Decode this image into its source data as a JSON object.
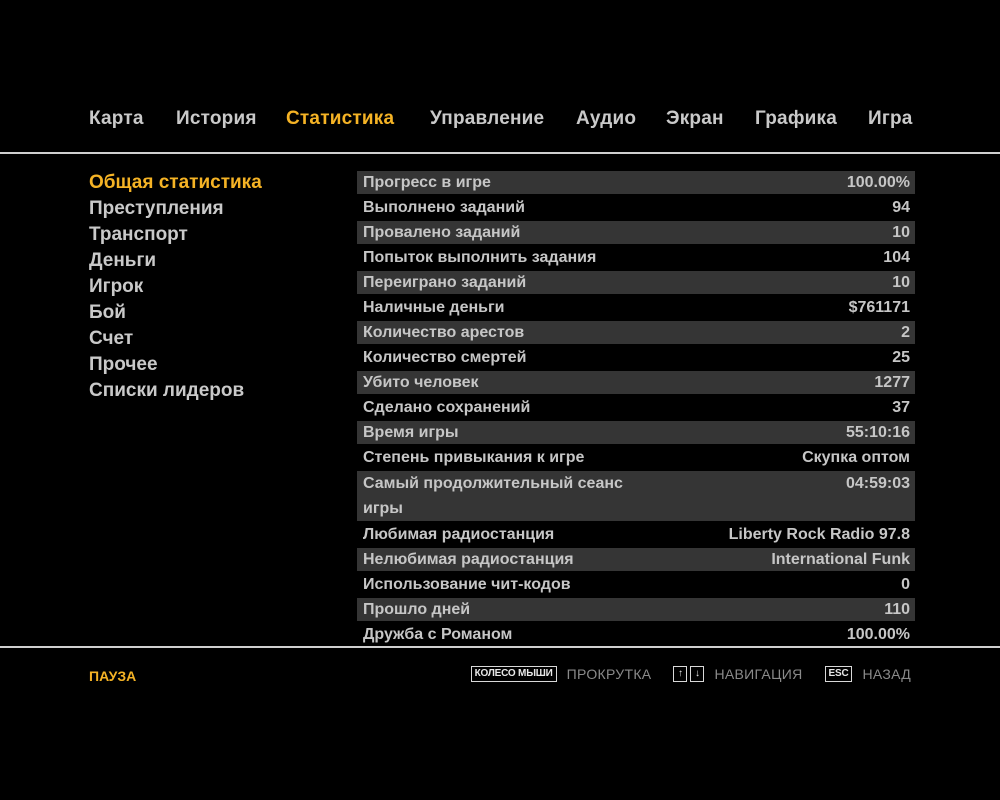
{
  "nav": {
    "tabs": [
      {
        "label": "Карта"
      },
      {
        "label": "История"
      },
      {
        "label": "Статистика",
        "active": true
      },
      {
        "label": "Управление"
      },
      {
        "label": "Аудио"
      },
      {
        "label": "Экран"
      },
      {
        "label": "Графика"
      },
      {
        "label": "Игра"
      }
    ]
  },
  "side_menu": {
    "items": [
      {
        "label": "Общая статистика",
        "active": true
      },
      {
        "label": "Преступления"
      },
      {
        "label": "Транспорт"
      },
      {
        "label": "Деньги"
      },
      {
        "label": "Игрок"
      },
      {
        "label": "Бой"
      },
      {
        "label": "Счет"
      },
      {
        "label": "Прочее"
      },
      {
        "label": "Списки лидеров"
      }
    ]
  },
  "stats": {
    "rows": [
      {
        "label": "Прогресс в игре",
        "value": "100.00%"
      },
      {
        "label": "Выполнено заданий",
        "value": "94"
      },
      {
        "label": "Провалено заданий",
        "value": "10"
      },
      {
        "label": "Попыток выполнить задания",
        "value": "104"
      },
      {
        "label": "Переиграно заданий",
        "value": "10"
      },
      {
        "label": "Наличные деньги",
        "value": "$761171"
      },
      {
        "label": "Количество арестов",
        "value": "2"
      },
      {
        "label": "Количество смертей",
        "value": "25"
      },
      {
        "label": "Убито человек",
        "value": "1277"
      },
      {
        "label": "Сделано сохранений",
        "value": "37"
      },
      {
        "label": "Время игры",
        "value": "55:10:16"
      },
      {
        "label": "Степень привыкания к игре",
        "value": "Скупка оптом"
      },
      {
        "label": "Самый продолжительный сеанс игры",
        "value": "04:59:03"
      },
      {
        "label": "Любимая радиостанция",
        "value": "Liberty Rock Radio 97.8"
      },
      {
        "label": "Нелюбимая радиостанция",
        "value": "International Funk"
      },
      {
        "label": "Использование чит-кодов",
        "value": "0"
      },
      {
        "label": "Прошло дней",
        "value": "110"
      },
      {
        "label": "Дружба с Романом",
        "value": "100.00%"
      }
    ]
  },
  "footer": {
    "pause_label": "ПАУЗА",
    "mouse_wheel_key": "КОЛЕСО МЫШИ",
    "scroll_label": "ПРОКРУТКА",
    "arrow_up": "↑",
    "arrow_down": "↓",
    "navigation_label": "НАВИГАЦИЯ",
    "esc_key": "ESC",
    "back_label": "НАЗАД"
  },
  "colors": {
    "accent": "#f5b325",
    "text": "#c9c9c9",
    "row_shade": "#353535",
    "background": "#000000"
  }
}
